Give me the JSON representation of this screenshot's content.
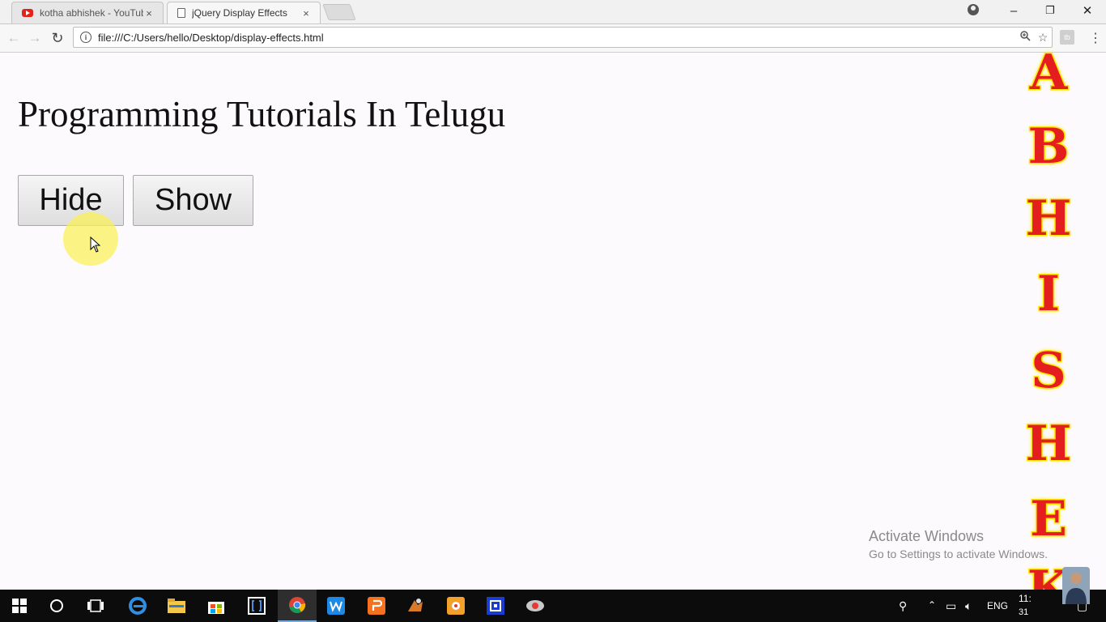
{
  "browser": {
    "tabs": [
      {
        "title": "kotha abhishek - YouTub",
        "icon": "youtube-icon",
        "active": false
      },
      {
        "title": "jQuery Display Effects",
        "icon": "document-icon",
        "active": true
      }
    ],
    "close_glyph": "×",
    "window_controls": {
      "minimize": "–",
      "restore": "❐",
      "close": "✕"
    },
    "url": "file:///C:/Users/hello/Desktop/display-effects.html",
    "nav_glyphs": {
      "back": "←",
      "forward": "→",
      "reload": "↻"
    }
  },
  "page": {
    "heading": "Programming Tutorials In Telugu",
    "buttons": {
      "hide": "Hide",
      "show": "Show"
    }
  },
  "overlay": {
    "activate_title": "Activate Windows",
    "activate_subtitle": "Go to Settings to activate Windows.",
    "watermark_letters": [
      "A",
      "B",
      "H",
      "I",
      "S",
      "H",
      "E",
      "K"
    ]
  },
  "taskbar": {
    "apps": [
      "start-icon",
      "search-icon",
      "task-view-icon",
      "edge-icon",
      "file-explorer-icon",
      "store-icon",
      "brackets-icon",
      "chrome-icon",
      "wps-writer-icon",
      "wps-presentation-icon",
      "app-icon",
      "paint-icon",
      "app-icon-2",
      "app-icon-3"
    ],
    "language": "ENG",
    "clock_fragment": "11:",
    "date_fragment": "31"
  }
}
